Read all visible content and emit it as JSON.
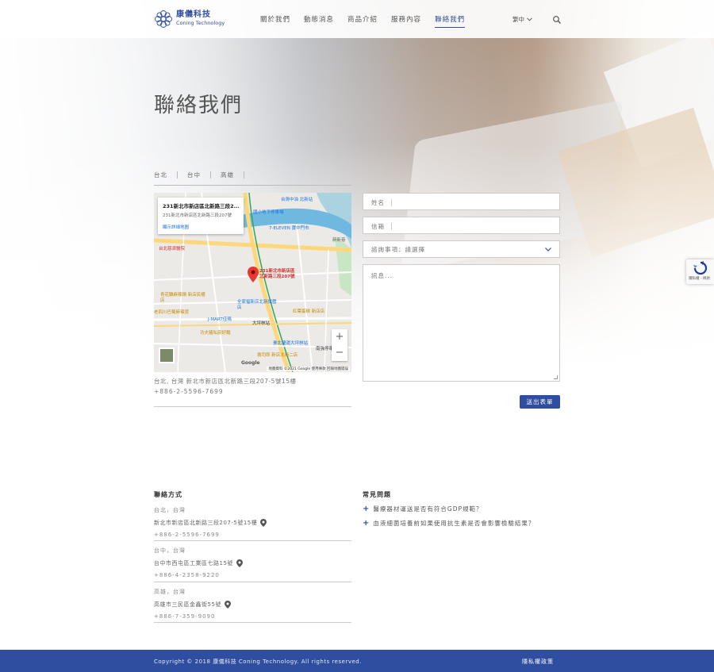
{
  "header": {
    "logo_cn": "康儀科技",
    "logo_en": "Coning Technology",
    "nav": [
      "關於我們",
      "動態消息",
      "商品介紹",
      "服務內容",
      "聯絡我們"
    ],
    "active_index": 4,
    "lang": "繁中"
  },
  "page_title": "聯絡我們",
  "tabs": [
    "台北",
    "台中",
    "高雄"
  ],
  "map": {
    "card_title": "231新北市新店區北新路三段2...",
    "card_addr": "231新北市新店區北新路三段207號",
    "card_link": "顯示詳細地圖",
    "pin_label": "231新北市新店區北新路三段207號",
    "labels": [
      "台北慈濟醫院",
      "臺北捷運大坪林站",
      "台灣中油 北新站",
      "7-ELEVEN 寶中門市",
      "J-MART佳瑪",
      "紅葉蛋糕 新店店",
      "功夫豬私廚好麵",
      "壽司郎 新店北新二店",
      "青花驕麻辣鍋 新店民權店",
      "老四川巴蜀麻辣燙",
      "全家福新店北新旗艦店",
      "大坪林站",
      "新新巷",
      "國小地下停車場",
      "南強停車場"
    ],
    "attribution": "地圖資料 ©2021 Google   使用條款   回報地圖錯誤",
    "google": "Google"
  },
  "address": "台北, 台灣 新北市新店區北新路三段207-5號15樓",
  "phone": "+886-2-5596-7699",
  "form": {
    "name_label": "姓名",
    "email_label": "信箱",
    "subject_label": "諮詢事項：請選擇",
    "message_placeholder": "訊息...",
    "submit": "送出表單"
  },
  "recaptcha": "隱私權 - 條款",
  "contact": {
    "title": "聯絡方式",
    "offices": [
      {
        "city": "台北，台灣",
        "addr": "新北市新店區北新路三段207-5號15樓",
        "phone": "+886-2-5596-7699"
      },
      {
        "city": "台中，台灣",
        "addr": "台中市西屯區工業區七路15號",
        "phone": "+886-4-2358-9220"
      },
      {
        "city": "高雄，台灣",
        "addr": "高雄市三民區金鑫街55號",
        "phone": "+886-7-359-9090"
      }
    ]
  },
  "faq": {
    "title": "常見問題",
    "items": [
      "醫療器材運送是否有符合GDP規範？",
      "血液細菌培養前如果使用抗生素是否會影響檢驗結果？"
    ]
  },
  "footer": {
    "copyright": "Copyright © 2018 康儀科技 Coning Technology. All rights reserved.",
    "privacy": "隱私權政策"
  },
  "colors": {
    "brand": "#2f4ea0",
    "map_pin": "#e53935"
  }
}
